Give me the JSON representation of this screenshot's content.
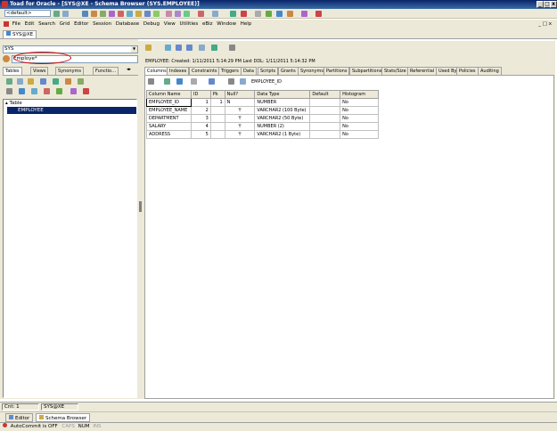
{
  "window": {
    "title": "Toad for Oracle - [SYS@XE - Schema Browser (SYS.EMPLOYEE)]",
    "min": "_",
    "max": "□",
    "close": "x"
  },
  "toolbar": {
    "default_select": "<default>"
  },
  "menu": {
    "items": [
      "File",
      "Edit",
      "Search",
      "Grid",
      "Editor",
      "Session",
      "Database",
      "Debug",
      "View",
      "Utilities",
      "eBiz",
      "Window",
      "Help"
    ],
    "restore": "_ □ x"
  },
  "doc_tab": {
    "label": "SYS@XE"
  },
  "left": {
    "schema": "SYS",
    "filter": "Employe*",
    "tabs": [
      "Tables",
      "Views",
      "Synonyms",
      "Functio…"
    ],
    "tree_root": "Table",
    "tree_items": [
      "EMPLOYEE"
    ]
  },
  "right": {
    "info": "EMPLOYEE:  Created: 1/11/2011 5:14:29 PM   Last DDL: 1/11/2011 5:14:32 PM",
    "tabs": [
      "Columns",
      "Indexes",
      "Constraints",
      "Triggers",
      "Data",
      "Scripts",
      "Grants",
      "Synonyms",
      "Partitions",
      "Subpartitions",
      "Stats/Size",
      "Referential",
      "Used By",
      "Policies",
      "Auditing"
    ],
    "toolbar_label": "EMPLOYEE_ID",
    "columns": [
      "Column Name",
      "ID",
      "Pk",
      "Null?",
      "Data Type",
      "Default",
      "Histogram"
    ],
    "rows": [
      [
        "EMPLOYEE_ID",
        "1",
        "1",
        "N",
        "NUMBER",
        "",
        "No"
      ],
      [
        "EMPLOYEE_NAME",
        "2",
        "",
        "Y",
        "VARCHAR2 (100 Byte)",
        "",
        "No"
      ],
      [
        "DEPARTMENT",
        "3",
        "",
        "Y",
        "VARCHAR2 (50 Byte)",
        "",
        "No"
      ],
      [
        "SALARY",
        "4",
        "",
        "Y",
        "NUMBER (2)",
        "",
        "No"
      ],
      [
        "ADDRESS",
        "5",
        "",
        "Y",
        "VARCHAR2 (1 Byte)",
        "",
        "No"
      ]
    ]
  },
  "status": {
    "count": "Cnt: 1",
    "conn": "SYS@XE"
  },
  "taskbar": {
    "editor": "Editor",
    "schema_browser": "Schema Browser"
  },
  "bottom": {
    "autocommit": "AutoCommit is OFF",
    "caps": "CAPS",
    "num": "NUM",
    "ins": "INS"
  }
}
